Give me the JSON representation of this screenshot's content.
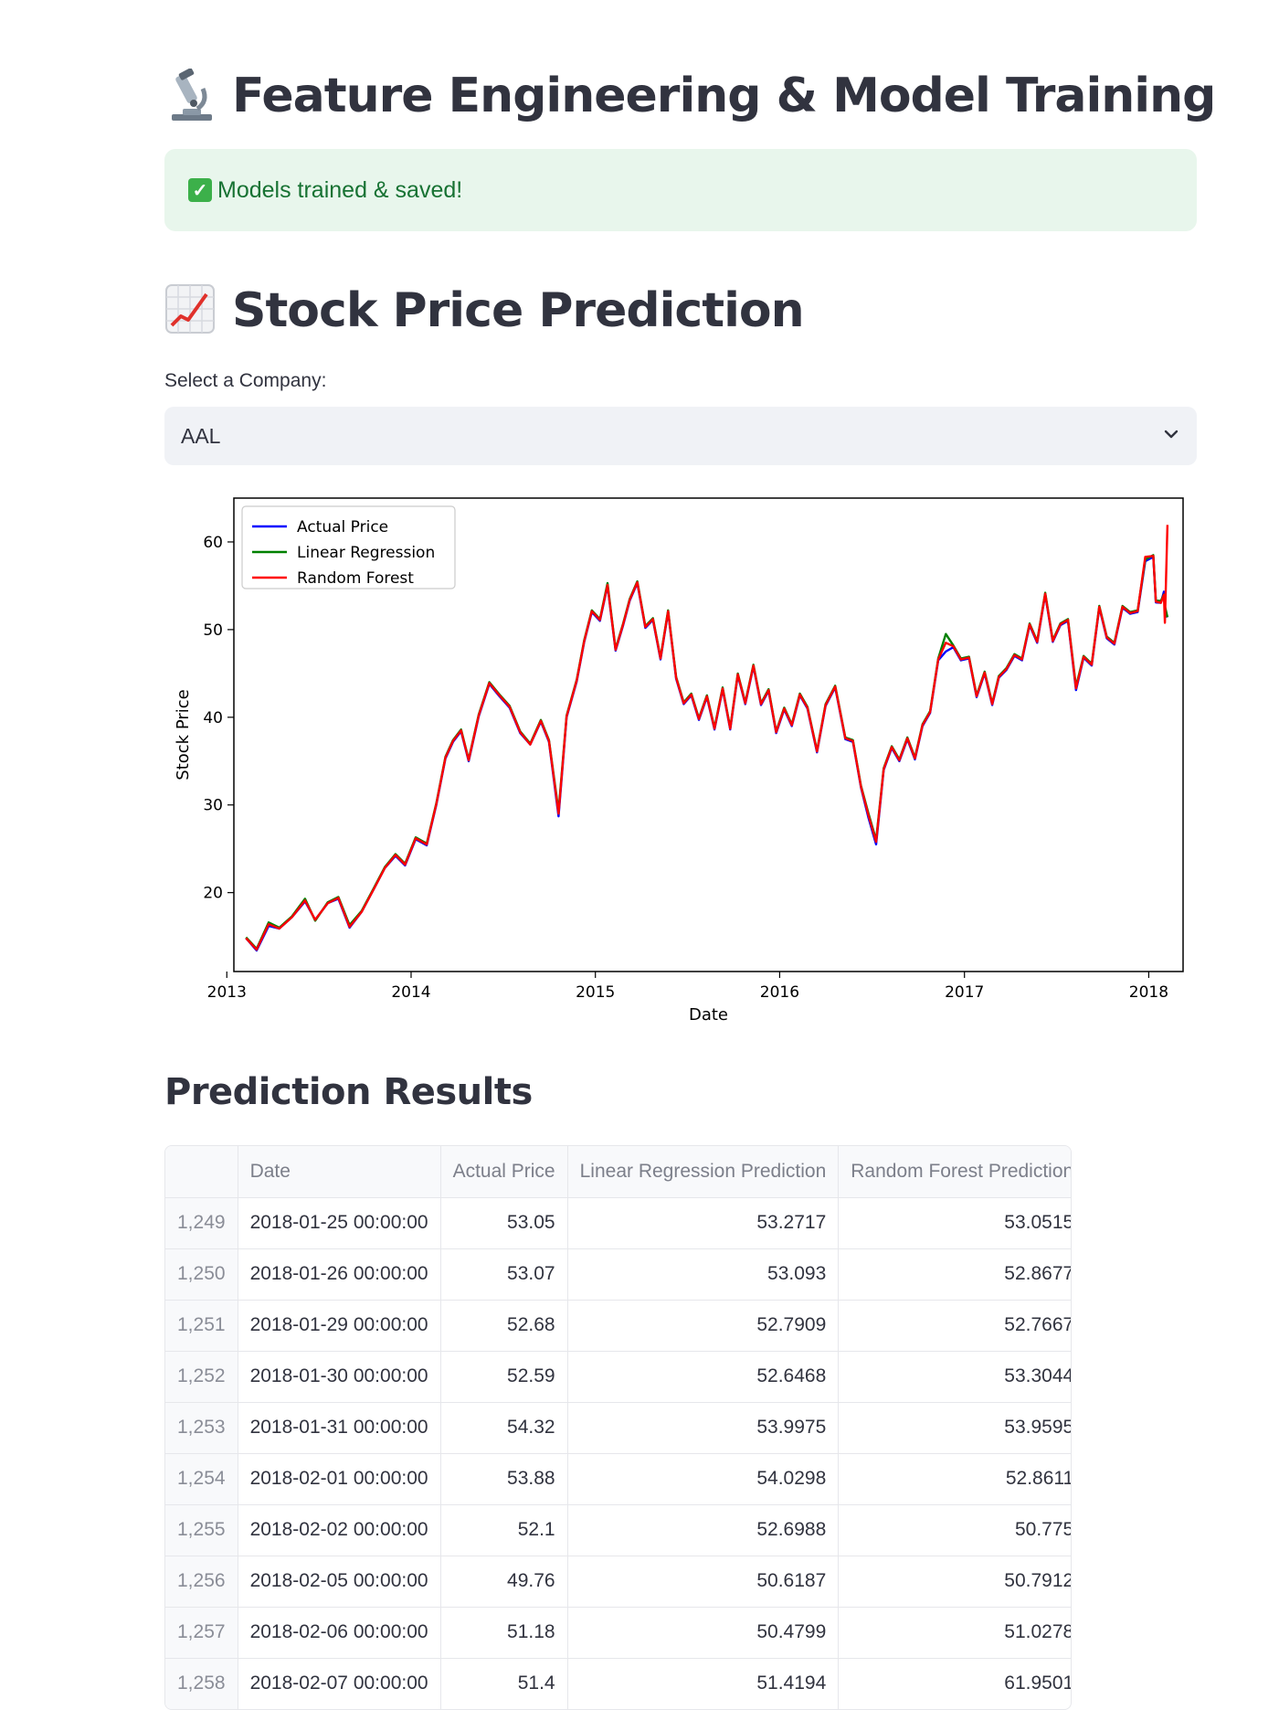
{
  "header": {
    "title": "Feature Engineering & Model Training",
    "icon": "microscope-icon"
  },
  "status": {
    "message": "Models trained & saved!",
    "icon": "check-icon",
    "color": "#177233",
    "background": "#e8f6ec"
  },
  "prediction_section": {
    "title": "Stock Price Prediction",
    "icon": "chart-increasing-icon"
  },
  "company_select": {
    "label": "Select a Company:",
    "value": "AAL"
  },
  "chart_data": {
    "type": "line",
    "xlabel": "Date",
    "ylabel": "Stock Price",
    "x_ticks": [
      "2013",
      "2014",
      "2015",
      "2016",
      "2017",
      "2018"
    ],
    "y_ticks": [
      20,
      30,
      40,
      50,
      60
    ],
    "xlim": [
      "2013-01-15",
      "2018-03-10"
    ],
    "ylim": [
      11,
      65
    ],
    "legend_position": "top-left",
    "series": [
      {
        "name": "Actual Price",
        "color": "#0000ff"
      },
      {
        "name": "Linear Regression",
        "color": "#008000"
      },
      {
        "name": "Random Forest",
        "color": "#ff0000"
      }
    ],
    "x": [
      "2013-02-08",
      "2013-03-01",
      "2013-03-25",
      "2013-04-15",
      "2013-05-10",
      "2013-06-05",
      "2013-06-25",
      "2013-07-20",
      "2013-08-10",
      "2013-09-01",
      "2013-09-25",
      "2013-10-20",
      "2013-11-10",
      "2013-12-01",
      "2013-12-20",
      "2014-01-10",
      "2014-02-01",
      "2014-02-20",
      "2014-03-10",
      "2014-03-25",
      "2014-04-10",
      "2014-04-25",
      "2014-05-15",
      "2014-06-05",
      "2014-06-25",
      "2014-07-15",
      "2014-08-05",
      "2014-08-25",
      "2014-09-15",
      "2014-10-01",
      "2014-10-20",
      "2014-11-05",
      "2014-11-25",
      "2014-12-10",
      "2014-12-25",
      "2015-01-10",
      "2015-01-25",
      "2015-02-10",
      "2015-02-25",
      "2015-03-10",
      "2015-03-25",
      "2015-04-10",
      "2015-04-25",
      "2015-05-10",
      "2015-05-25",
      "2015-06-10",
      "2015-06-25",
      "2015-07-10",
      "2015-07-25",
      "2015-08-10",
      "2015-08-25",
      "2015-09-10",
      "2015-09-25",
      "2015-10-10",
      "2015-10-25",
      "2015-11-10",
      "2015-11-25",
      "2015-12-10",
      "2015-12-25",
      "2016-01-10",
      "2016-01-25",
      "2016-02-10",
      "2016-02-25",
      "2016-03-15",
      "2016-04-01",
      "2016-04-20",
      "2016-05-10",
      "2016-05-25",
      "2016-06-10",
      "2016-06-25",
      "2016-07-10",
      "2016-07-25",
      "2016-08-10",
      "2016-08-25",
      "2016-09-10",
      "2016-09-25",
      "2016-10-10",
      "2016-10-25",
      "2016-11-10",
      "2016-11-25",
      "2016-12-10",
      "2016-12-25",
      "2017-01-10",
      "2017-01-25",
      "2017-02-10",
      "2017-02-25",
      "2017-03-10",
      "2017-03-25",
      "2017-04-10",
      "2017-04-25",
      "2017-05-10",
      "2017-05-25",
      "2017-06-10",
      "2017-06-25",
      "2017-07-10",
      "2017-07-25",
      "2017-08-10",
      "2017-08-25",
      "2017-09-10",
      "2017-09-25",
      "2017-10-10",
      "2017-10-25",
      "2017-11-10",
      "2017-11-25",
      "2017-12-10",
      "2017-12-25",
      "2018-01-10",
      "2018-01-15",
      "2018-01-25",
      "2018-01-31",
      "2018-02-02",
      "2018-02-07"
    ],
    "actual": [
      14.8,
      13.4,
      16.2,
      15.9,
      17.2,
      19.0,
      16.9,
      18.8,
      19.3,
      16.0,
      17.8,
      20.5,
      22.8,
      24.2,
      23.1,
      26.1,
      25.4,
      30.0,
      35.3,
      37.2,
      38.4,
      35.0,
      40.1,
      43.8,
      42.4,
      41.1,
      38.2,
      36.9,
      39.5,
      37.2,
      28.7,
      40.0,
      44.1,
      48.6,
      52.0,
      51.0,
      55.0,
      47.6,
      50.5,
      53.3,
      55.3,
      50.2,
      51.1,
      46.6,
      52.0,
      44.4,
      41.5,
      42.5,
      39.7,
      42.3,
      38.6,
      43.2,
      38.6,
      44.8,
      41.5,
      45.8,
      41.4,
      43.0,
      38.2,
      40.9,
      39.0,
      42.5,
      41.0,
      36.0,
      41.3,
      43.4,
      37.5,
      37.2,
      32.0,
      28.5,
      25.5,
      34.0,
      36.5,
      35.0,
      37.5,
      35.2,
      39.0,
      40.5,
      46.5,
      47.5,
      48.0,
      46.5,
      46.7,
      42.3,
      45.0,
      41.4,
      44.5,
      45.4,
      47.0,
      46.5,
      50.5,
      48.5,
      54.0,
      48.6,
      50.5,
      51.0,
      43.1,
      46.8,
      45.9,
      52.5,
      49.0,
      48.3,
      52.5,
      51.8,
      52.0,
      57.8,
      58.3,
      53.1,
      53.05,
      54.32,
      52.1,
      51.4
    ],
    "linear_regression": [
      14.9,
      13.6,
      16.6,
      16.0,
      17.3,
      19.3,
      16.8,
      18.9,
      19.5,
      16.3,
      17.9,
      20.6,
      22.9,
      24.4,
      23.3,
      26.3,
      25.6,
      30.2,
      35.5,
      37.4,
      38.6,
      35.2,
      40.3,
      44.0,
      42.6,
      41.3,
      38.4,
      37.0,
      39.7,
      37.4,
      29.3,
      40.2,
      44.3,
      48.8,
      52.2,
      51.2,
      55.3,
      47.8,
      50.7,
      53.5,
      55.5,
      50.4,
      51.3,
      46.8,
      52.2,
      44.6,
      41.7,
      42.7,
      39.9,
      42.5,
      38.8,
      43.4,
      38.8,
      45.0,
      41.7,
      46.0,
      41.6,
      43.2,
      38.4,
      41.1,
      39.2,
      42.7,
      41.2,
      36.2,
      41.5,
      43.6,
      37.7,
      37.4,
      32.2,
      29.0,
      26.0,
      34.2,
      36.7,
      35.2,
      37.7,
      35.4,
      39.2,
      40.7,
      46.7,
      49.5,
      48.2,
      46.7,
      46.9,
      42.5,
      45.2,
      41.6,
      44.7,
      45.6,
      47.2,
      46.7,
      50.7,
      48.7,
      54.2,
      48.8,
      50.7,
      51.2,
      43.5,
      47.0,
      46.1,
      52.7,
      49.2,
      48.5,
      52.7,
      52.0,
      52.2,
      58.0,
      58.5,
      53.3,
      53.27,
      54.0,
      52.7,
      51.42
    ],
    "random_forest": [
      14.8,
      13.5,
      16.4,
      15.9,
      17.2,
      19.1,
      16.9,
      18.8,
      19.4,
      16.1,
      17.8,
      20.5,
      22.8,
      24.3,
      23.2,
      26.2,
      25.5,
      30.1,
      35.4,
      37.3,
      38.5,
      35.1,
      40.2,
      43.9,
      42.5,
      41.2,
      38.3,
      36.9,
      39.6,
      37.3,
      29.0,
      40.1,
      44.2,
      48.7,
      52.1,
      51.1,
      55.1,
      47.7,
      50.6,
      53.4,
      55.4,
      50.3,
      51.2,
      46.7,
      52.1,
      44.5,
      41.6,
      42.6,
      39.8,
      42.4,
      38.7,
      43.3,
      38.7,
      44.9,
      41.6,
      45.9,
      41.5,
      43.1,
      38.3,
      41.0,
      39.1,
      42.6,
      41.1,
      36.1,
      41.4,
      43.5,
      37.6,
      37.3,
      32.1,
      28.8,
      25.8,
      34.1,
      36.6,
      35.1,
      37.6,
      35.3,
      39.1,
      40.6,
      46.6,
      48.5,
      48.1,
      46.6,
      46.8,
      42.4,
      45.1,
      41.5,
      44.6,
      45.5,
      47.1,
      46.6,
      50.6,
      48.6,
      54.1,
      48.7,
      50.6,
      51.1,
      43.3,
      46.9,
      46.0,
      52.6,
      49.1,
      48.4,
      52.6,
      51.9,
      52.1,
      58.3,
      58.4,
      53.2,
      53.05,
      53.96,
      50.78,
      61.95
    ]
  },
  "results": {
    "title": "Prediction Results",
    "columns": [
      "",
      "Date",
      "Actual Price",
      "Linear Regression Prediction",
      "Random Forest Prediction"
    ],
    "rows": [
      [
        "1,249",
        "2018-01-25 00:00:00",
        "53.05",
        "53.2717",
        "53.0515"
      ],
      [
        "1,250",
        "2018-01-26 00:00:00",
        "53.07",
        "53.093",
        "52.8677"
      ],
      [
        "1,251",
        "2018-01-29 00:00:00",
        "52.68",
        "52.7909",
        "52.7667"
      ],
      [
        "1,252",
        "2018-01-30 00:00:00",
        "52.59",
        "52.6468",
        "53.3044"
      ],
      [
        "1,253",
        "2018-01-31 00:00:00",
        "54.32",
        "53.9975",
        "53.9595"
      ],
      [
        "1,254",
        "2018-02-01 00:00:00",
        "53.88",
        "54.0298",
        "52.8611"
      ],
      [
        "1,255",
        "2018-02-02 00:00:00",
        "52.1",
        "52.6988",
        "50.775"
      ],
      [
        "1,256",
        "2018-02-05 00:00:00",
        "49.76",
        "50.6187",
        "50.7912"
      ],
      [
        "1,257",
        "2018-02-06 00:00:00",
        "51.18",
        "50.4799",
        "51.0278"
      ],
      [
        "1,258",
        "2018-02-07 00:00:00",
        "51.4",
        "51.4194",
        "61.9501"
      ]
    ]
  }
}
